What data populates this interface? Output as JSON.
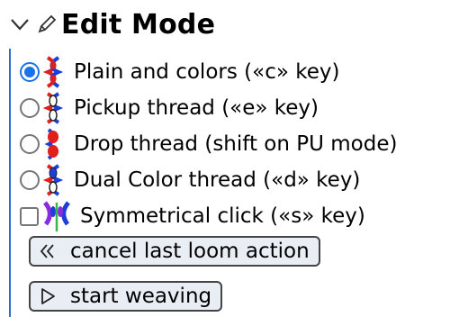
{
  "header": {
    "title": "Edit Mode",
    "chevron_icon": "chevron-down-icon",
    "pencil_icon": "pencil-icon"
  },
  "modes": [
    {
      "label": "Plain and colors («c» key)",
      "checked": true,
      "icon": "plain-thread-icon"
    },
    {
      "label": "Pickup thread («e» key)",
      "checked": false,
      "icon": "pickup-thread-icon"
    },
    {
      "label": "Drop thread (shift on PU mode)",
      "checked": false,
      "icon": "drop-thread-icon"
    },
    {
      "label": "Dual Color thread («d» key)",
      "checked": false,
      "icon": "dual-color-thread-icon"
    }
  ],
  "symmetrical": {
    "label": "Symmetrical click («s» key)",
    "checked": false,
    "icon": "symmetrical-icon"
  },
  "buttons": {
    "cancel_label": "cancel last loom action",
    "cancel_icon": "double-chevron-left-icon",
    "start_label": "start weaving",
    "start_icon": "play-icon"
  },
  "colors": {
    "accent": "#1a73e8",
    "thread_red": "#e0201b",
    "thread_blue": "#1c3fd8",
    "sym_purple": "#8a2be2",
    "sym_green": "#3cb44b"
  }
}
